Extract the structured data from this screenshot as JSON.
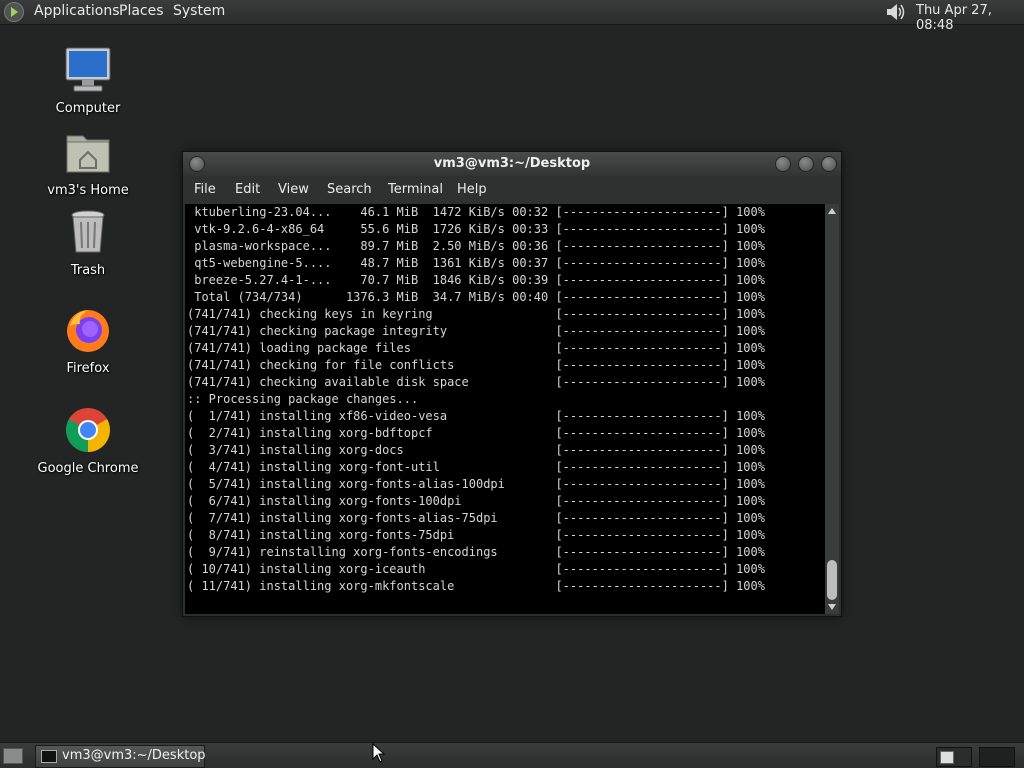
{
  "top_panel": {
    "menus": [
      "Applications",
      "Places",
      "System"
    ],
    "clock": "Thu Apr 27, 08:48",
    "icons": {
      "logo": "distro-logo-icon",
      "volume": "speaker-icon"
    }
  },
  "desktop_icons": [
    {
      "label": "Computer",
      "icon": "computer-icon"
    },
    {
      "label": "vm3's Home",
      "icon": "home-folder-icon"
    },
    {
      "label": "Trash",
      "icon": "trash-icon"
    },
    {
      "label": "Firefox",
      "icon": "firefox-icon"
    },
    {
      "label": "Google Chrome",
      "icon": "chrome-icon"
    }
  ],
  "terminal": {
    "title": "vm3@vm3:~/Desktop",
    "menu": [
      "File",
      "Edit",
      "View",
      "Search",
      "Terminal",
      "Help"
    ],
    "lines": [
      " ktuberling-23.04...    46.1 MiB  1472 KiB/s 00:32 [----------------------] 100%",
      " vtk-9.2.6-4-x86_64     55.6 MiB  1726 KiB/s 00:33 [----------------------] 100%",
      " plasma-workspace...    89.7 MiB  2.50 MiB/s 00:36 [----------------------] 100%",
      " qt5-webengine-5....    48.7 MiB  1361 KiB/s 00:37 [----------------------] 100%",
      " breeze-5.27.4-1-...    70.7 MiB  1846 KiB/s 00:39 [----------------------] 100%",
      " Total (734/734)      1376.3 MiB  34.7 MiB/s 00:40 [----------------------] 100%",
      "(741/741) checking keys in keyring                 [----------------------] 100%",
      "(741/741) checking package integrity               [----------------------] 100%",
      "(741/741) loading package files                    [----------------------] 100%",
      "(741/741) checking for file conflicts              [----------------------] 100%",
      "(741/741) checking available disk space            [----------------------] 100%",
      ":: Processing package changes...",
      "(  1/741) installing xf86-video-vesa               [----------------------] 100%",
      "(  2/741) installing xorg-bdftopcf                 [----------------------] 100%",
      "(  3/741) installing xorg-docs                     [----------------------] 100%",
      "(  4/741) installing xorg-font-util                [----------------------] 100%",
      "(  5/741) installing xorg-fonts-alias-100dpi       [----------------------] 100%",
      "(  6/741) installing xorg-fonts-100dpi             [----------------------] 100%",
      "(  7/741) installing xorg-fonts-alias-75dpi        [----------------------] 100%",
      "(  8/741) installing xorg-fonts-75dpi              [----------------------] 100%",
      "(  9/741) reinstalling xorg-fonts-encodings        [----------------------] 100%",
      "( 10/741) installing xorg-iceauth                  [----------------------] 100%",
      "( 11/741) installing xorg-mkfontscale              [----------------------] 100%"
    ]
  },
  "bottom_panel": {
    "task_label": "vm3@vm3:~/Desktop"
  }
}
